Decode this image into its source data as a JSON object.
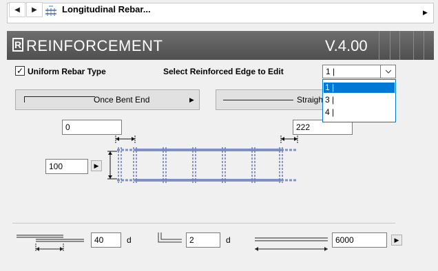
{
  "nav": {
    "title": "Longitudinal Rebar...",
    "back_icon": "triangle-left",
    "forward_icon": "triangle-right",
    "expand_icon": "triangle-right"
  },
  "banner": {
    "logo": "R",
    "title": "REINFORCEMENT",
    "version": "V.4.00"
  },
  "uniform": {
    "label": "Uniform Rebar Type",
    "checked": true
  },
  "edge": {
    "label": "Select Reinforced Edge to Edit",
    "value": "1 |",
    "options": [
      "1 |",
      "3 |",
      "4 |"
    ],
    "selected_index": 0
  },
  "shapes": {
    "left_label": "Once Bent End",
    "right_label": "Straight"
  },
  "dims": {
    "left_offset": "0",
    "right_offset": "222",
    "spacing": "100"
  },
  "bottom": {
    "lap_length": "40",
    "lap_unit": "d",
    "hook_length": "2",
    "hook_unit": "d",
    "bar_length": "6000"
  },
  "colors": {
    "accent": "#0078d7",
    "rebar": "#7f8fc8"
  }
}
